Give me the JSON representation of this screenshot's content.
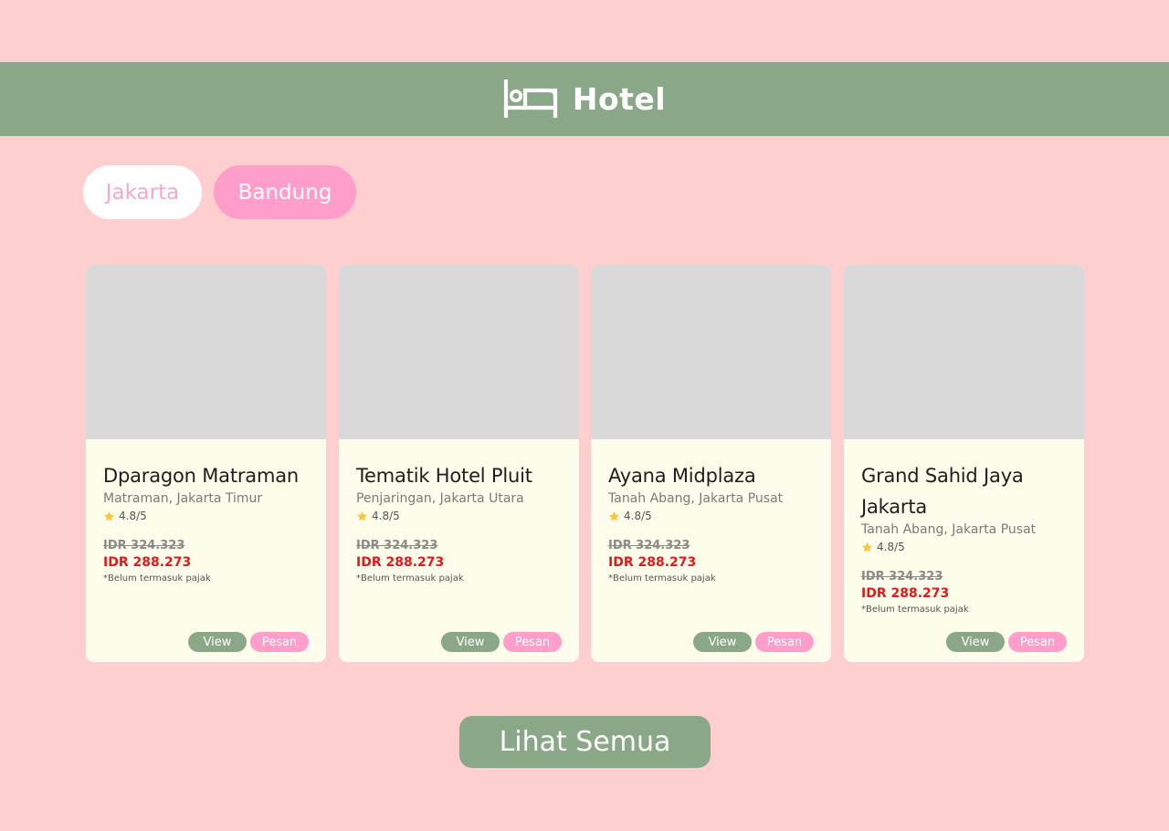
{
  "header": {
    "title": "Hotel",
    "icon": "bed-icon"
  },
  "tabs": [
    {
      "label": "Jakarta",
      "active": true
    },
    {
      "label": "Bandung",
      "active": false
    }
  ],
  "hotels": [
    {
      "name": "Dparagon Matraman",
      "location": "Matraman, Jakarta Timur",
      "rating": "4.8/5",
      "price_old": "IDR 324.323",
      "price_new": "IDR 288.273",
      "tax_note": "*Belum termasuk pajak",
      "view_label": "View",
      "book_label": "Pesan"
    },
    {
      "name": "Tematik Hotel Pluit",
      "location": "Penjaringan, Jakarta Utara",
      "rating": "4.8/5",
      "price_old": "IDR 324.323",
      "price_new": "IDR 288.273",
      "tax_note": "*Belum termasuk pajak",
      "view_label": "View",
      "book_label": "Pesan"
    },
    {
      "name": "Ayana Midplaza",
      "location": "Tanah Abang, Jakarta Pusat",
      "rating": "4.8/5",
      "price_old": "IDR 324.323",
      "price_new": "IDR 288.273",
      "tax_note": "*Belum termasuk pajak",
      "view_label": "View",
      "book_label": "Pesan"
    },
    {
      "name": "Grand Sahid Jaya Jakarta",
      "location": "Tanah Abang, Jakarta Pusat",
      "rating": "4.8/5",
      "price_old": "IDR 324.323",
      "price_new": "IDR 288.273",
      "tax_note": "*Belum termasuk pajak",
      "view_label": "View",
      "book_label": "Pesan"
    }
  ],
  "see_all_label": "Lihat Semua",
  "colors": {
    "background": "#FFCFD0",
    "header": "#8AA888",
    "accent_pink": "#FF9DCB",
    "card": "#FEFCEA",
    "price_red": "#E01A1A"
  }
}
